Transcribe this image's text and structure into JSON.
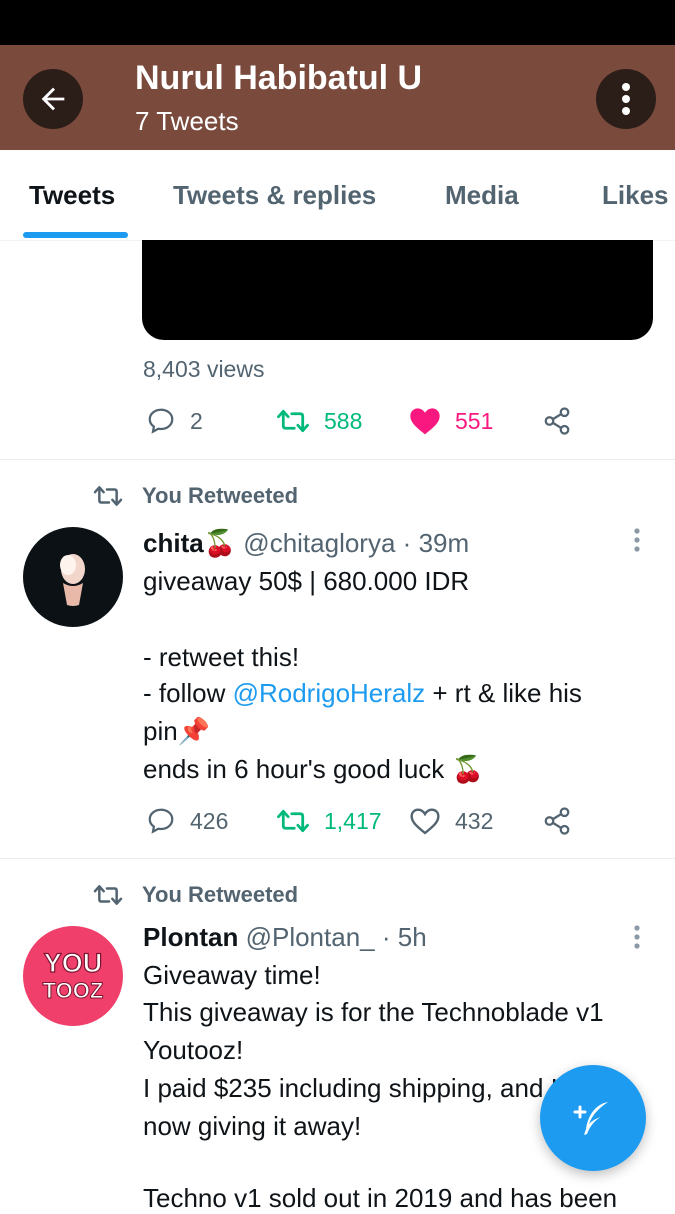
{
  "header": {
    "title": "Nurul Habibatul U",
    "subtitle": "7 Tweets",
    "bg_color": "#7a4a3c"
  },
  "tabs": [
    {
      "label": "Tweets",
      "active": true
    },
    {
      "label": "Tweets & replies",
      "active": false
    },
    {
      "label": "Media",
      "active": false
    },
    {
      "label": "Likes",
      "active": false
    }
  ],
  "first_tweet": {
    "views": "8,403 views",
    "replies": "2",
    "retweets": "588",
    "likes": "551",
    "liked": true,
    "retweeted": true
  },
  "tweet_chita": {
    "retweet_label": "You Retweeted",
    "name": "chita",
    "name_emoji": "🍒",
    "handle": "@chitaglorya",
    "separator": "·",
    "time": "39m",
    "line1": "giveaway 50$ | 680.000 IDR",
    "line2": "- retweet this!",
    "line3_prefix": "- follow ",
    "line3_mention": "@RodrigoHeralz",
    "line3_suffix": " + rt & like his",
    "line4": "pin📌",
    "line5": "ends in 6 hour's good luck 🍒",
    "replies": "426",
    "retweets": "1,417",
    "likes": "432"
  },
  "tweet_plontan": {
    "retweet_label": "You Retweeted",
    "name": "Plontan",
    "handle": "@Plontan_",
    "separator": "·",
    "time": "5h",
    "avatar_text_1": "YOU",
    "avatar_text_2": "TOOZ",
    "line1": "Giveaway time!",
    "line2": "This giveaway is for the Technoblade v1",
    "line3": "Youtooz!",
    "line4": "I paid $235 including shipping, and I am",
    "line5": "now giving it away!",
    "line6": "Techno v1 sold out in 2019 and has been"
  },
  "colors": {
    "accent": "#1d9bf0",
    "retweet_green": "#00ba7c",
    "like_pink": "#f91880"
  },
  "icons": {
    "back": "arrow-left-icon",
    "more": "vertical-dots-icon",
    "reply": "speech-bubble-icon",
    "retweet": "retweet-arrows-icon",
    "like": "heart-icon",
    "share": "share-nodes-icon",
    "compose": "feather-plus-icon"
  }
}
